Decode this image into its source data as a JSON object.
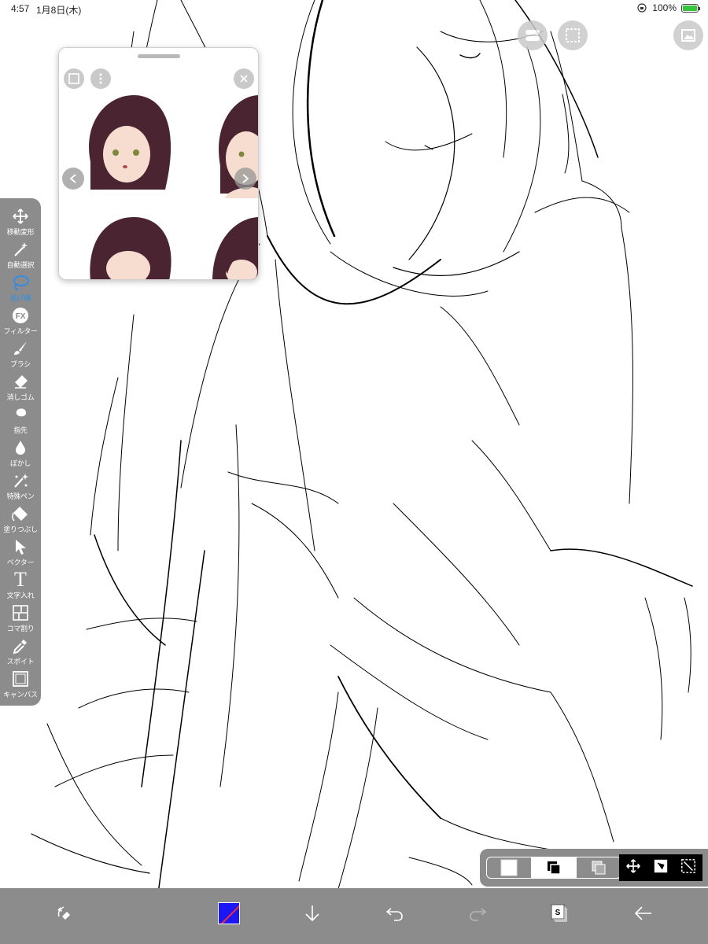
{
  "status_bar": {
    "time": "4:57",
    "date": "1月8日(木)",
    "battery": "100%"
  },
  "toolbar": {
    "tools": [
      {
        "label": "移動変形",
        "icon": "move-icon"
      },
      {
        "label": "自動選択",
        "icon": "magic-wand-icon"
      },
      {
        "label": "投げ縄",
        "icon": "lasso-icon",
        "active": true
      },
      {
        "label": "フィルター",
        "icon": "fx-icon",
        "icon_text": "FX"
      },
      {
        "label": "ブラシ",
        "icon": "brush-icon"
      },
      {
        "label": "消しゴム",
        "icon": "eraser-icon"
      },
      {
        "label": "指先",
        "icon": "smudge-icon"
      },
      {
        "label": "ぼかし",
        "icon": "blur-icon"
      },
      {
        "label": "特殊ペン",
        "icon": "special-pen-icon"
      },
      {
        "label": "塗りつぶし",
        "icon": "fill-icon"
      },
      {
        "label": "ベクター",
        "icon": "vector-icon"
      },
      {
        "label": "文字入れ",
        "icon": "text-icon",
        "icon_text": "T"
      },
      {
        "label": "コマ割り",
        "icon": "panel-icon"
      },
      {
        "label": "スポイト",
        "icon": "eyedropper-icon"
      },
      {
        "label": "キャンバス",
        "icon": "canvas-icon"
      }
    ]
  },
  "reference_window": {
    "icons": [
      "reference-icon",
      "more-icon",
      "close-icon",
      "prev-icon",
      "next-icon"
    ]
  },
  "bottom_bar": {
    "colors": {
      "primary": "#1b16f5",
      "accent": "#2f8fe8",
      "bar": "#8c8c8c"
    },
    "icons": [
      "brush-size-icon",
      "color-swatch",
      "download-icon",
      "undo-icon",
      "redo-icon",
      "layers-icon",
      "back-icon"
    ],
    "layers_badge": "S"
  }
}
